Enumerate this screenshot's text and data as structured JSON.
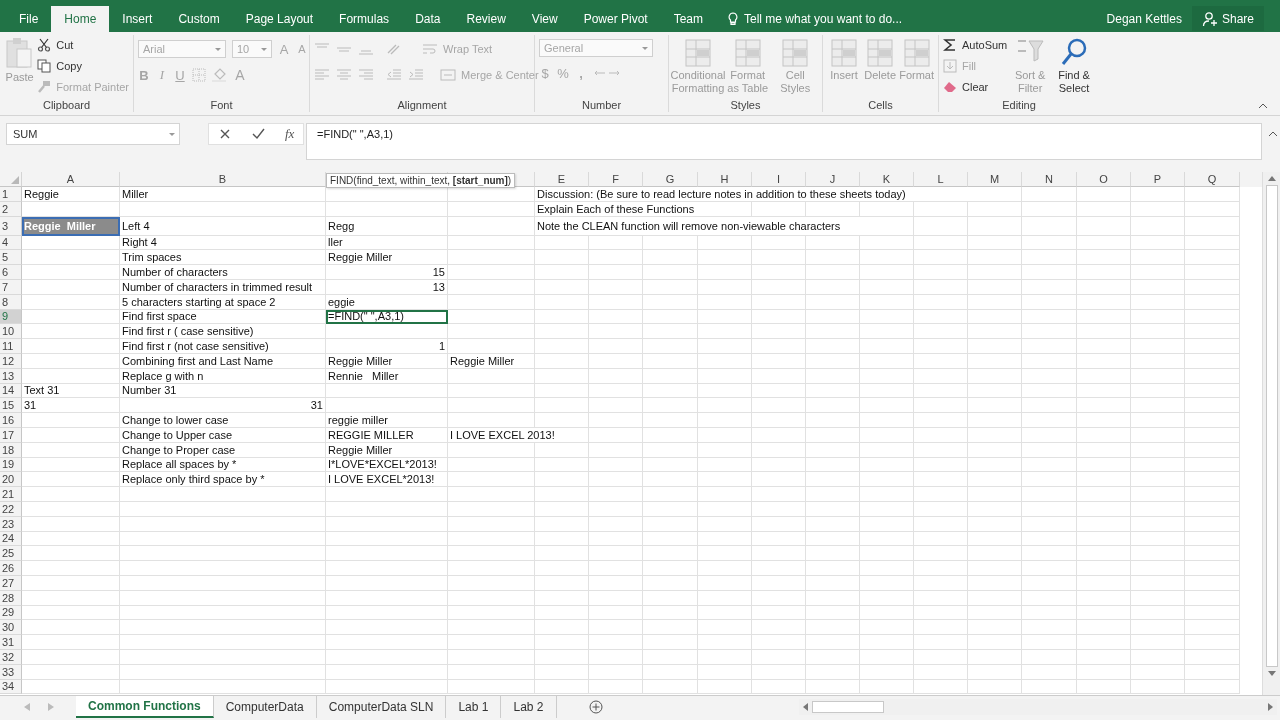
{
  "menu": {
    "tabs": [
      {
        "label": "File",
        "selected": false
      },
      {
        "label": "Home",
        "selected": true
      },
      {
        "label": "Insert",
        "selected": false
      },
      {
        "label": "Custom",
        "selected": false
      },
      {
        "label": "Page Layout",
        "selected": false
      },
      {
        "label": "Formulas",
        "selected": false
      },
      {
        "label": "Data",
        "selected": false
      },
      {
        "label": "Review",
        "selected": false
      },
      {
        "label": "View",
        "selected": false
      },
      {
        "label": "Power Pivot",
        "selected": false
      },
      {
        "label": "Team",
        "selected": false
      }
    ],
    "tell_me": "Tell me what you want to do...",
    "user": "Degan Kettles",
    "share": "Share"
  },
  "ribbon": {
    "groups": [
      {
        "kind": "clipboard",
        "label": "Clipboard",
        "paste": {
          "label": "Paste",
          "disabled": true
        },
        "items": [
          {
            "label": "Cut",
            "disabled": false
          },
          {
            "label": "Copy",
            "disabled": false
          },
          {
            "label": "Format Painter",
            "disabled": true
          }
        ]
      },
      {
        "kind": "font",
        "label": "Font",
        "font_name": "Arial",
        "font_size": "10",
        "grow": "A",
        "shrink": "A",
        "bold": "B",
        "italic": "I",
        "underline": "U",
        "font_color": "A"
      },
      {
        "kind": "alignment",
        "label": "Alignment",
        "wrap": "Wrap Text",
        "merge": "Merge & Center"
      },
      {
        "kind": "number",
        "label": "Number",
        "format": "General",
        "currency": "$",
        "percent": "%",
        "comma": ","
      },
      {
        "kind": "styles",
        "label": "Styles",
        "buttons": [
          {
            "label": "Conditional Formatting",
            "disabled": true
          },
          {
            "label": "Format as Table",
            "disabled": true
          },
          {
            "label": "Cell Styles",
            "disabled": true
          }
        ]
      },
      {
        "kind": "cells",
        "label": "Cells",
        "buttons": [
          {
            "label": "Insert",
            "disabled": true
          },
          {
            "label": "Delete",
            "disabled": true
          },
          {
            "label": "Format",
            "disabled": true
          }
        ]
      },
      {
        "kind": "editing",
        "label": "Editing",
        "items": [
          {
            "label": "AutoSum",
            "disabled": false
          },
          {
            "label": "Fill",
            "disabled": true
          },
          {
            "label": "Clear",
            "disabled": false
          }
        ],
        "buttons": [
          {
            "label": "Sort & Filter",
            "disabled": true
          },
          {
            "label": "Find & Select",
            "disabled": false
          }
        ]
      }
    ]
  },
  "formula_bar": {
    "name_box": "SUM",
    "function_button": "fx",
    "formula": "=FIND(\" \",A3,1)"
  },
  "tooltip": "FIND(find_text, within_text, **[start_num]**)",
  "grid": {
    "columns": [
      "A",
      "B",
      null,
      null,
      "E",
      "F",
      "G",
      "H",
      "I",
      "J",
      "K",
      "L",
      "M",
      "N",
      "O",
      "P",
      "Q"
    ],
    "rows": [
      {
        "number": "1",
        "selected": false,
        "cells": [
          {
            "text": "Reggie",
            "kind": "text"
          },
          {
            "text": "Miller",
            "kind": "text"
          },
          null,
          null,
          {
            "text": "Discussion: (Be sure to read lecture notes in addition to these sheets today)",
            "kind": "text"
          }
        ]
      },
      {
        "number": "2",
        "selected": false,
        "cells": [
          null,
          null,
          null,
          null,
          {
            "text": "Explain Each of these Functions",
            "kind": "text"
          }
        ]
      },
      {
        "number": "3",
        "selected": false,
        "cells": [
          {
            "text": "Reggie  Miller",
            "kind": "text",
            "referenced": true
          },
          {
            "text": "Left 4",
            "kind": "text"
          },
          {
            "text": "Regg",
            "kind": "text"
          },
          null,
          {
            "text": "Note the CLEAN function will remove non-viewable characters",
            "kind": "text"
          }
        ]
      },
      {
        "number": "4",
        "selected": false,
        "cells": [
          null,
          {
            "text": "Right 4",
            "kind": "text"
          },
          {
            "text": "ller",
            "kind": "text"
          }
        ]
      },
      {
        "number": "5",
        "selected": false,
        "cells": [
          null,
          {
            "text": "Trim spaces",
            "kind": "text"
          },
          {
            "text": "Reggie Miller",
            "kind": "text"
          }
        ]
      },
      {
        "number": "6",
        "selected": false,
        "cells": [
          null,
          {
            "text": "Number of characters",
            "kind": "text"
          },
          {
            "text": "15",
            "kind": "number"
          }
        ]
      },
      {
        "number": "7",
        "selected": false,
        "cells": [
          null,
          {
            "text": "Number of characters in trimmed result",
            "kind": "text"
          },
          {
            "text": "13",
            "kind": "number"
          }
        ]
      },
      {
        "number": "8",
        "selected": false,
        "cells": [
          null,
          {
            "text": "5 characters starting at space 2",
            "kind": "text"
          },
          {
            "text": "eggie",
            "kind": "text"
          }
        ]
      },
      {
        "number": "9",
        "selected": true,
        "cells": [
          null,
          {
            "text": "Find first space",
            "kind": "text"
          },
          {
            "text": "=FIND(\" \",A3,1)",
            "kind": "text",
            "editing": true
          }
        ]
      },
      {
        "number": "10",
        "selected": false,
        "cells": [
          null,
          {
            "text": "Find first r ( case sensitive)",
            "kind": "text"
          }
        ]
      },
      {
        "number": "11",
        "selected": false,
        "cells": [
          null,
          {
            "text": "Find first r (not case sensitive)",
            "kind": "text"
          },
          {
            "text": "1",
            "kind": "number"
          }
        ]
      },
      {
        "number": "12",
        "selected": false,
        "cells": [
          null,
          {
            "text": "Combining first and Last Name",
            "kind": "text"
          },
          {
            "text": "Reggie Miller",
            "kind": "text"
          },
          {
            "text": "Reggie Miller",
            "kind": "text"
          }
        ]
      },
      {
        "number": "13",
        "selected": false,
        "cells": [
          null,
          {
            "text": "Replace g with n",
            "kind": "text"
          },
          {
            "text": "Rennie   Miller",
            "kind": "text"
          }
        ]
      },
      {
        "number": "14",
        "selected": false,
        "cells": [
          {
            "text": "Text 31",
            "kind": "text"
          },
          {
            "text": "Number 31",
            "kind": "text"
          }
        ]
      },
      {
        "number": "15",
        "selected": false,
        "cells": [
          {
            "text": "31",
            "kind": "text"
          },
          {
            "text": "31",
            "kind": "number"
          }
        ]
      },
      {
        "number": "16",
        "selected": false,
        "cells": [
          null,
          {
            "text": "Change to lower case",
            "kind": "text"
          },
          {
            "text": "reggie miller",
            "kind": "text"
          }
        ]
      },
      {
        "number": "17",
        "selected": false,
        "cells": [
          null,
          {
            "text": "Change to Upper case",
            "kind": "text"
          },
          {
            "text": "REGGIE MILLER",
            "kind": "text"
          },
          {
            "text": "I LOVE EXCEL 2013!",
            "kind": "text"
          }
        ]
      },
      {
        "number": "18",
        "selected": false,
        "cells": [
          null,
          {
            "text": "Change to Proper case",
            "kind": "text"
          },
          {
            "text": "Reggie Miller",
            "kind": "text"
          }
        ]
      },
      {
        "number": "19",
        "selected": false,
        "cells": [
          null,
          {
            "text": "Replace all spaces by *",
            "kind": "text"
          },
          {
            "text": "I*LOVE*EXCEL*2013!",
            "kind": "text"
          }
        ]
      },
      {
        "number": "20",
        "selected": false,
        "cells": [
          null,
          {
            "text": "Replace only third space by *",
            "kind": "text"
          },
          {
            "text": "I LOVE EXCEL*2013!",
            "kind": "text"
          }
        ]
      },
      {
        "number": "21",
        "selected": false
      },
      {
        "number": "22",
        "selected": false
      },
      {
        "number": "23",
        "selected": false
      },
      {
        "number": "24",
        "selected": false
      },
      {
        "number": "25",
        "selected": false
      },
      {
        "number": "26",
        "selected": false
      },
      {
        "number": "27",
        "selected": false
      },
      {
        "number": "28",
        "selected": false
      },
      {
        "number": "29",
        "selected": false
      },
      {
        "number": "30",
        "selected": false
      },
      {
        "number": "31",
        "selected": false
      },
      {
        "number": "32",
        "selected": false
      },
      {
        "number": "33",
        "selected": false
      },
      {
        "number": "34",
        "selected": false
      }
    ]
  },
  "sheet_tabs": [
    {
      "label": "Common Functions",
      "selected": true
    },
    {
      "label": "ComputerData",
      "selected": false
    },
    {
      "label": "ComputerData SLN",
      "selected": false
    },
    {
      "label": "Lab 1",
      "selected": false
    },
    {
      "label": "Lab 2",
      "selected": false
    }
  ]
}
